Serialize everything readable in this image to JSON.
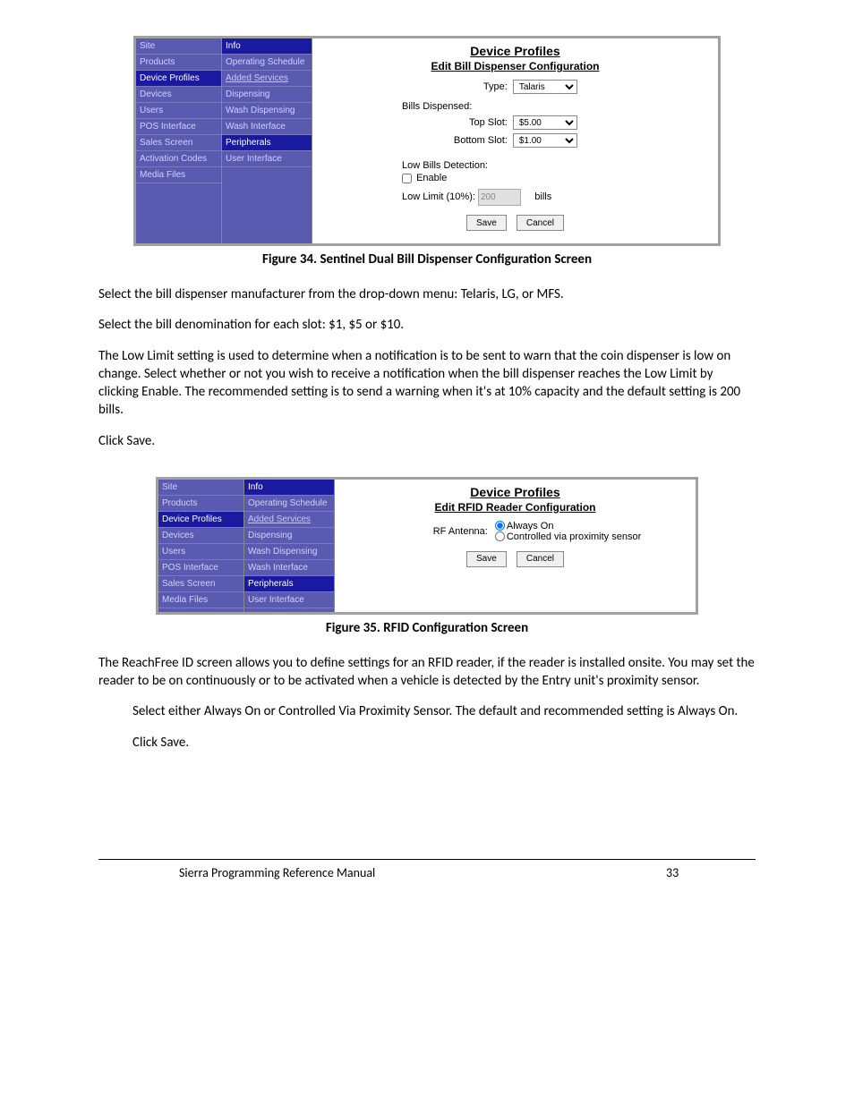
{
  "screenshot1": {
    "nav1": [
      "Site",
      "Products",
      "Device Profiles",
      "Devices",
      "Users",
      "POS Interface",
      "Sales Screen",
      "Activation Codes",
      "Media Files"
    ],
    "nav1_selected_index": 2,
    "nav2_top": "Info",
    "nav2": [
      "Operating Schedule",
      "Added Services",
      "Dispensing",
      "Wash Dispensing",
      "Wash Interface",
      "Peripherals",
      "User Interface"
    ],
    "nav2_selected_index": 5,
    "header1": "Device Profiles",
    "header2": "Edit Bill Dispenser Configuration",
    "type_label": "Type:",
    "type_value": "Talaris",
    "bills_label": "Bills Dispensed:",
    "top_slot_label": "Top Slot:",
    "top_slot_value": "$5.00",
    "bottom_slot_label": "Bottom Slot:",
    "bottom_slot_value": "$1.00",
    "low_bills_label": "Low Bills Detection:",
    "enable_label": "Enable",
    "low_limit_label": "Low Limit (10%):",
    "low_limit_value": "200",
    "low_limit_suffix": "bills",
    "save": "Save",
    "cancel": "Cancel"
  },
  "caption1": "Figure 34. Sentinel Dual Bill Dispenser Configuration Screen",
  "para1": "Select the bill dispenser manufacturer from the drop-down menu: Telaris, LG, or MFS.",
  "para2": "Select the bill denomination for each slot: $1, $5 or $10.",
  "para3": "The Low Limit setting is used to determine when a notification is to be sent to warn that the coin dispenser is low on change. Select whether or not you wish to receive a notification when the bill dispenser reaches the Low Limit by clicking Enable. The recommended setting is to send a warning when it's at 10% capacity and the default setting is 200 bills.",
  "para4": "Click Save.",
  "screenshot2": {
    "nav1": [
      "Site",
      "Products",
      "Device Profiles",
      "Devices",
      "Users",
      "POS Interface",
      "Sales Screen",
      "Media Files"
    ],
    "nav1_selected_index": 2,
    "nav2_top": "Info",
    "nav2": [
      "Operating Schedule",
      "Added Services",
      "Dispensing",
      "Wash Dispensing",
      "Wash Interface",
      "Peripherals",
      "User Interface"
    ],
    "nav2_selected_index": 5,
    "header1": "Device Profiles",
    "header2": "Edit RFID Reader Configuration",
    "rf_label": "RF Antenna:",
    "opt1": "Always On",
    "opt2": "Controlled via proximity sensor",
    "save": "Save",
    "cancel": "Cancel"
  },
  "caption2": "Figure 35. RFID Configuration Screen",
  "para5": "The ReachFree ID screen allows you to define settings for an RFID reader, if the reader is installed onsite. You may set the reader to be on continuously or to be activated when a vehicle is detected by the Entry unit's proximity sensor.",
  "para6": "Select either Always On or Controlled Via Proximity Sensor. The default and recommended setting is Always On.",
  "para7": "Click Save.",
  "footer_title": "Sierra Programming Reference Manual",
  "footer_page": "33"
}
